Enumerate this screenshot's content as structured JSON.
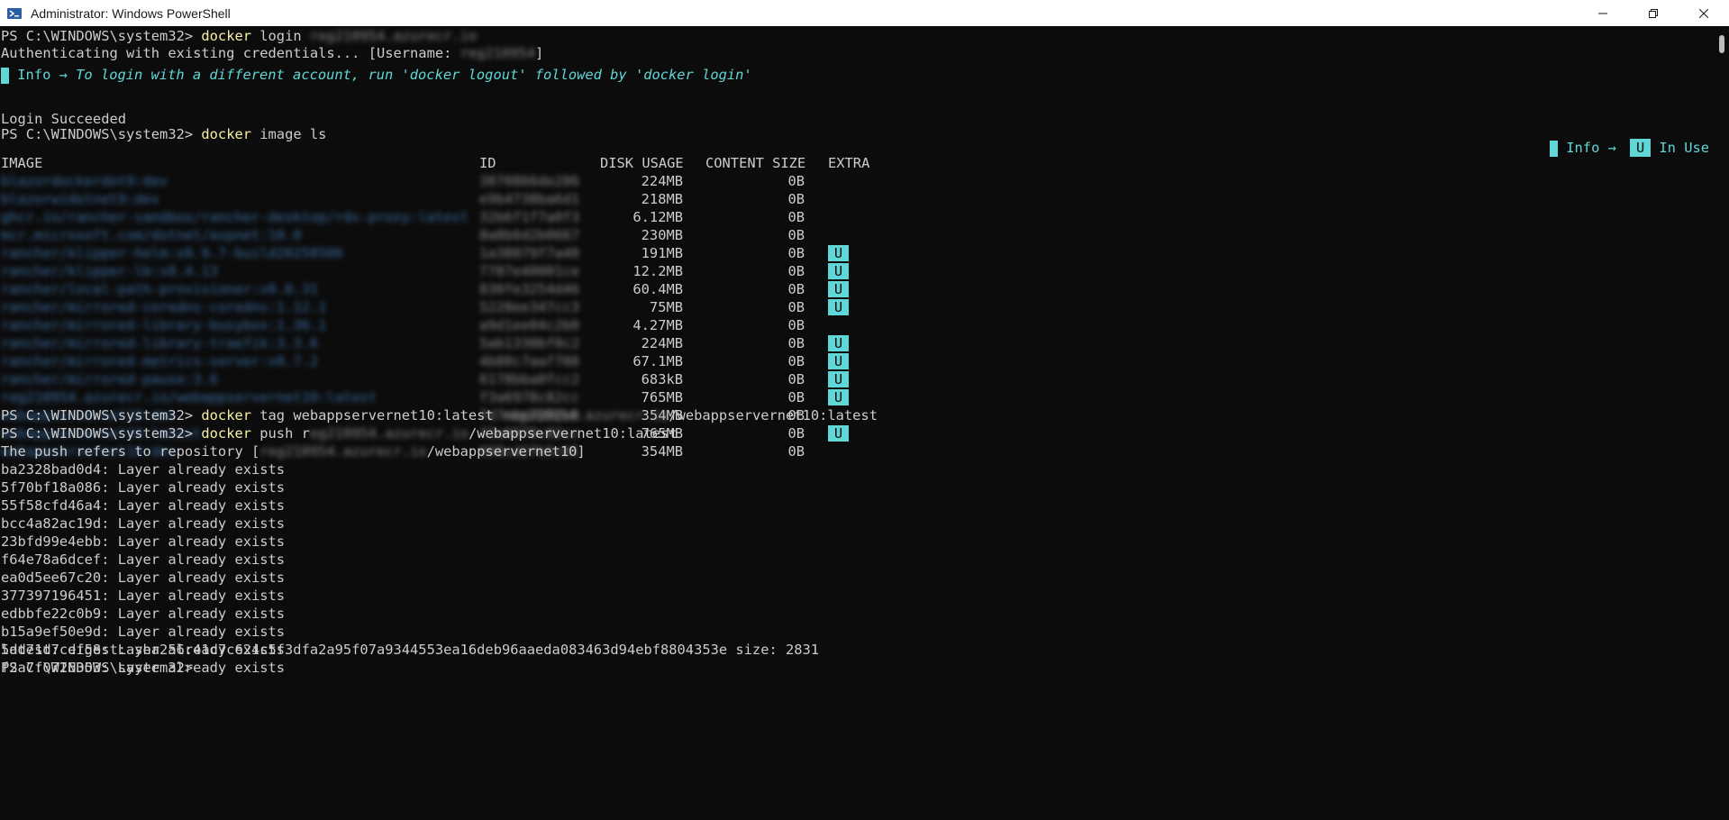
{
  "window": {
    "title": "Administrator: Windows PowerShell",
    "minimize_icon": "minimize-icon",
    "maximize_icon": "restore-icon",
    "close_icon": "close-icon"
  },
  "colors": {
    "background": "#0c0c0c",
    "foreground": "#cccccc",
    "command": "#f9f1a5",
    "info": "#61d6d6",
    "image_names": "#3a6ea5"
  },
  "terminal": {
    "prompt": "PS C:\\WINDOWS\\system32> ",
    "line1_cmd": "docker",
    "line1_arg": " login ",
    "line1_blur": "reg210954.azurecr.io",
    "line2_text": "Authenticating with existing credentials... [Username: ",
    "line2_blur": "reg210954",
    "line2_end": "]",
    "info_label": " Info → ",
    "info_message": "To login with a different account, run 'docker logout' followed by 'docker login'",
    "login_succeeded": "Login Succeeded",
    "line_image_ls_cmd": "docker",
    "line_image_ls_arg": " image ls",
    "legend_info": " Info → ",
    "legend_u": "U",
    "legend_in_use": " In Use",
    "table": {
      "headers": {
        "image": "IMAGE",
        "id": "ID",
        "disk_usage": "DISK USAGE",
        "content_size": "CONTENT SIZE",
        "extra": "EXTRA"
      },
      "rows": [
        {
          "image": "blazordockerdot9:dev",
          "id": "3870866de286",
          "disk": "224MB",
          "content": "0B",
          "extra": ""
        },
        {
          "image": "blazorwidotnet9:dev",
          "id": "e9b4738ba6d1",
          "disk": "218MB",
          "content": "0B",
          "extra": ""
        },
        {
          "image": "ghcr.io/rancher-sandbox/rancher-desktop/rdx-proxy:latest",
          "id": "32b6f1f7a0f3",
          "disk": "6.12MB",
          "content": "0B",
          "extra": ""
        },
        {
          "image": "mcr.microsoft.com/dotnet/aspnet:10.0",
          "id": "8a8b6d2b0667",
          "disk": "230MB",
          "content": "0B",
          "extra": ""
        },
        {
          "image": "rancher/klipper-helm:v0.9.7-build20250506",
          "id": "1a38079f7a40",
          "disk": "191MB",
          "content": "0B",
          "extra": "U"
        },
        {
          "image": "rancher/klipper-lb:v0.4.13",
          "id": "7787e40001ce",
          "disk": "12.2MB",
          "content": "0B",
          "extra": "U"
        },
        {
          "image": "rancher/local-path-provisioner:v0.0.31",
          "id": "830fe3254d46",
          "disk": "60.4MB",
          "content": "0B",
          "extra": "U"
        },
        {
          "image": "rancher/mirrored-coredns-coredns:1.12.1",
          "id": "5228ee347cc3",
          "disk": "75MB",
          "content": "0B",
          "extra": "U"
        },
        {
          "image": "rancher/mirrored-library-busybox:1.36.1",
          "id": "a9d1ee04c2b0",
          "disk": "4.27MB",
          "content": "0B",
          "extra": ""
        },
        {
          "image": "rancher/mirrored-library-traefik:3.3.6",
          "id": "5ab1330bf0c2",
          "disk": "224MB",
          "content": "0B",
          "extra": "U"
        },
        {
          "image": "rancher/mirrored-metrics-server:v0.7.2",
          "id": "4b80c7aaf708",
          "disk": "67.1MB",
          "content": "0B",
          "extra": "U"
        },
        {
          "image": "rancher/mirrored-pause:3.6",
          "id": "6178bba0fcc2",
          "disk": "683kB",
          "content": "0B",
          "extra": "U"
        },
        {
          "image": "reg210954.azurecr.io/webappservernet10:latest",
          "id": "f3a6978c82cc",
          "disk": "765MB",
          "content": "0B",
          "extra": "U"
        },
        {
          "image": "webappservernet10:dev",
          "id": "7d7ebe4992e0",
          "disk": "354MB",
          "content": "0B",
          "extra": ""
        },
        {
          "image": "webappservernet10:latest",
          "id": "f3a6978c82cc",
          "disk": "765MB",
          "content": "0B",
          "extra": "U"
        },
        {
          "image": "webappservernet10:dev",
          "id": "998cd27b5c01",
          "disk": "354MB",
          "content": "0B",
          "extra": ""
        }
      ]
    },
    "tag_cmd": "docker",
    "tag_arg": " tag webappservernet10:latest ",
    "tag_blur": "reg210954.azurecr.io",
    "tag_end": "/webappservernet10:latest",
    "push_cmd": "docker",
    "push_arg": " push r",
    "push_blur": "eg210954.azurecr.io",
    "push_end": "/webappservernet10:latest",
    "push_refers": "The push refers to repository [",
    "push_refers_blur": "reg210954.azurecr.io",
    "push_refers_end": "/webappservernet10]",
    "layers": [
      "ba2328bad0d4: Layer already exists",
      "5f70bf18a086: Layer already exists",
      "55f58cfd46a4: Layer already exists",
      "bcc4a82ac19d: Layer already exists",
      "23bfd99e4ebb: Layer already exists",
      "f64e78a6dcef: Layer already exists",
      "ea0d5ee67c20: Layer already exists",
      "377397196451: Layer already exists",
      "edbbfe22c0b9: Layer already exists",
      "b15a9ef50e9d: Layer already exists",
      "5dd71d7cef58: Layer already exists",
      "f2a7f0726353: Layer already exists"
    ],
    "digest": "latest: digest: sha256:41c7c624c5f3dfa2a95f07a9344553ea16deb96aaeda083463d94ebf8804353e size: 2831",
    "final_prompt": "PS C:\\WINDOWS\\system32> "
  }
}
